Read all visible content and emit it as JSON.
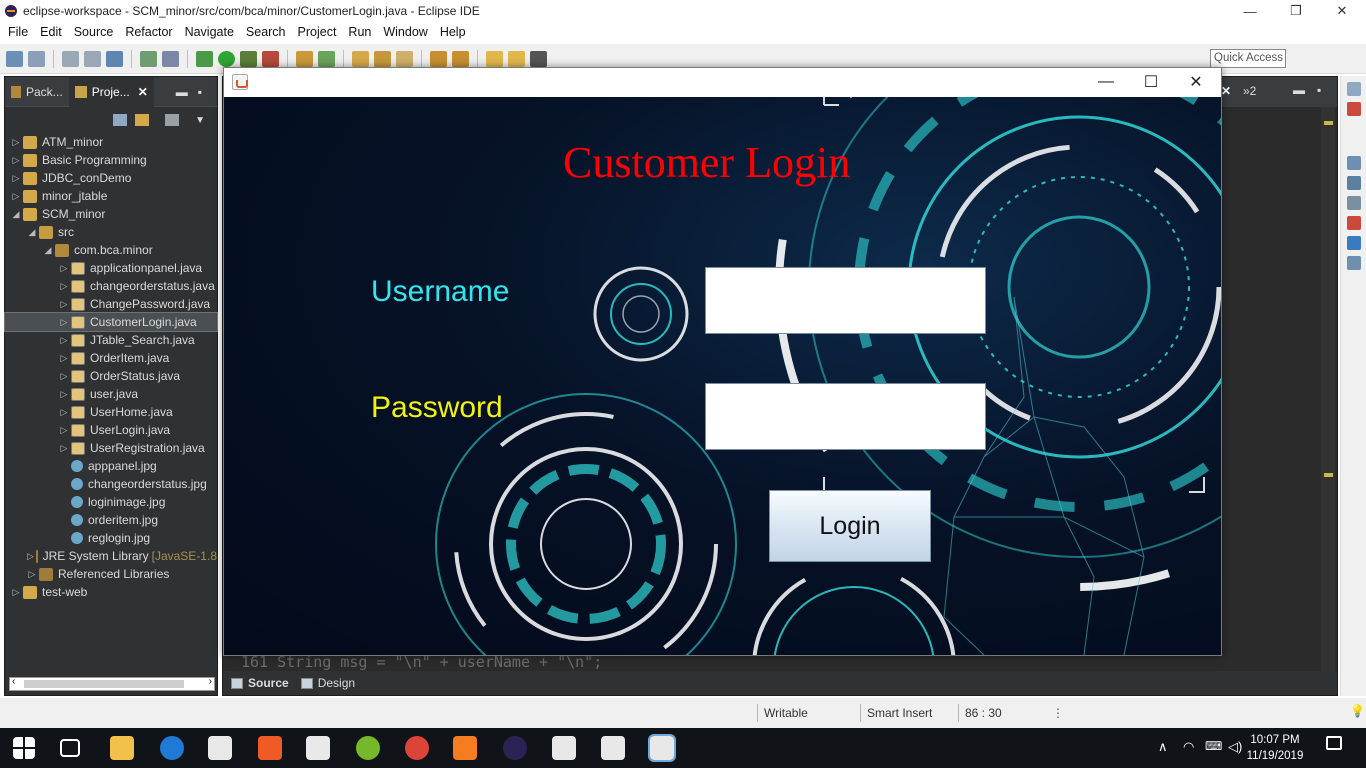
{
  "window": {
    "title": "eclipse-workspace - SCM_minor/src/com/bca/minor/CustomerLogin.java - Eclipse IDE",
    "minimize": "—",
    "restore": "❐",
    "close": "✕"
  },
  "menu": [
    "File",
    "Edit",
    "Source",
    "Refactor",
    "Navigate",
    "Search",
    "Project",
    "Run",
    "Window",
    "Help"
  ],
  "toolbar": {
    "quick_access": "Quick Access"
  },
  "explorer": {
    "tabs": [
      {
        "label": "Pack..."
      },
      {
        "label": "Proje...",
        "close": "✕"
      }
    ],
    "tree": [
      {
        "label": "ATM_minor",
        "indent": 0,
        "arrow": "▷",
        "icon": "project-icon"
      },
      {
        "label": "Basic Programming",
        "indent": 0,
        "arrow": "▷",
        "icon": "project-icon"
      },
      {
        "label": "JDBC_conDemo",
        "indent": 0,
        "arrow": "▷",
        "icon": "project-icon"
      },
      {
        "label": "minor_jtable",
        "indent": 0,
        "arrow": "▷",
        "icon": "project-icon"
      },
      {
        "label": "SCM_minor",
        "indent": 0,
        "arrow": "◢",
        "icon": "project-icon"
      },
      {
        "label": "src",
        "indent": 1,
        "arrow": "◢",
        "icon": "source-folder-icon"
      },
      {
        "label": "com.bca.minor",
        "indent": 2,
        "arrow": "◢",
        "icon": "package-icon"
      },
      {
        "label": "applicationpanel.java",
        "indent": 3,
        "arrow": "▷",
        "icon": "java-file-icon"
      },
      {
        "label": "changeorderstatus.java",
        "indent": 3,
        "arrow": "▷",
        "icon": "java-file-icon"
      },
      {
        "label": "ChangePassword.java",
        "indent": 3,
        "arrow": "▷",
        "icon": "java-file-icon"
      },
      {
        "label": "CustomerLogin.java",
        "indent": 3,
        "arrow": "▷",
        "icon": "java-file-icon",
        "selected": true
      },
      {
        "label": "JTable_Search.java",
        "indent": 3,
        "arrow": "▷",
        "icon": "java-file-icon"
      },
      {
        "label": "OrderItem.java",
        "indent": 3,
        "arrow": "▷",
        "icon": "java-file-icon"
      },
      {
        "label": "OrderStatus.java",
        "indent": 3,
        "arrow": "▷",
        "icon": "java-file-icon"
      },
      {
        "label": "user.java",
        "indent": 3,
        "arrow": "▷",
        "icon": "java-file-icon"
      },
      {
        "label": "UserHome.java",
        "indent": 3,
        "arrow": "▷",
        "icon": "java-file-icon"
      },
      {
        "label": "UserLogin.java",
        "indent": 3,
        "arrow": "▷",
        "icon": "java-file-icon"
      },
      {
        "label": "UserRegistration.java",
        "indent": 3,
        "arrow": "▷",
        "icon": "java-file-icon"
      },
      {
        "label": "apppanel.jpg",
        "indent": 3,
        "arrow": "",
        "icon": "image-file-icon"
      },
      {
        "label": "changeorderstatus.jpg",
        "indent": 3,
        "arrow": "",
        "icon": "image-file-icon"
      },
      {
        "label": "loginimage.jpg",
        "indent": 3,
        "arrow": "",
        "icon": "image-file-icon"
      },
      {
        "label": "orderitem.jpg",
        "indent": 3,
        "arrow": "",
        "icon": "image-file-icon"
      },
      {
        "label": "reglogin.jpg",
        "indent": 3,
        "arrow": "",
        "icon": "image-file-icon"
      },
      {
        "label": "JRE System Library",
        "extra": "[JavaSE-1.8",
        "indent": 1,
        "arrow": "▷",
        "icon": "library-icon"
      },
      {
        "label": "Referenced Libraries",
        "indent": 1,
        "arrow": "▷",
        "icon": "library-icon"
      },
      {
        "label": "test-web",
        "indent": 0,
        "arrow": "▷",
        "icon": "project-icon"
      }
    ]
  },
  "editor": {
    "bottom_tabs": [
      "Source",
      "Design"
    ],
    "code_line": "161         String msg = \"\\n\" + userName + \"\\n\";",
    "overflow_tab": "»2"
  },
  "statusbar": {
    "mode": "Writable",
    "insert": "Smart Insert",
    "position": "86 : 30"
  },
  "taskbar": {
    "time": "10:07 PM",
    "date": "11/19/2019"
  },
  "login_frame": {
    "title_icon": "java-icon",
    "heading": "Customer Login",
    "username_label": "Username",
    "password_label": "Password",
    "username_value": "",
    "password_value": "",
    "login_button": "Login",
    "colors": {
      "heading": "#ff0000",
      "username_label": "#33e6ee",
      "password_label": "#f2f20f",
      "background": "#061227",
      "hud": "#2fd6d6"
    }
  }
}
